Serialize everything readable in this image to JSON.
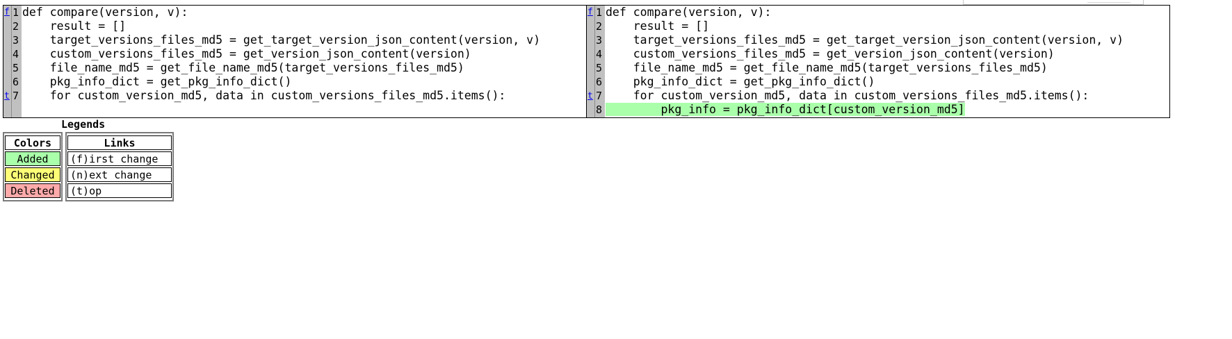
{
  "left_pane": {
    "nav": {
      "first": "f",
      "top": "t"
    },
    "line_numbers": [
      "1",
      "2",
      "3",
      "4",
      "5",
      "6",
      "7"
    ],
    "lines": [
      "def compare(version, v):",
      "    result = []",
      "    target_versions_files_md5 = get_target_version_json_content(version, v)",
      "    custom_versions_files_md5 = get_version_json_content(version)",
      "    file_name_md5 = get_file_name_md5(target_versions_files_md5)",
      "    pkg_info_dict = get_pkg_info_dict()",
      "    for custom_version_md5, data in custom_versions_files_md5.items():"
    ]
  },
  "right_pane": {
    "nav": {
      "first": "f",
      "top": "t"
    },
    "line_numbers": [
      "1",
      "2",
      "3",
      "4",
      "5",
      "6",
      "7",
      "8"
    ],
    "lines": [
      "def compare(version, v):",
      "    result = []",
      "    target_versions_files_md5 = get_target_version_json_content(version, v)",
      "    custom_versions_files_md5 = get_version_json_content(version)",
      "    file_name_md5 = get_file_name_md5(target_versions_files_md5)",
      "    pkg_info_dict = get_pkg_info_dict()",
      "    for custom_version_md5, data in custom_versions_files_md5.items():"
    ],
    "added_line_indent": "        ",
    "added_line": "pkg_info = pkg_info_dict[custom_version_md5]"
  },
  "legend": {
    "title": "Legends",
    "colors_header": "Colors",
    "links_header": "Links",
    "colors": [
      "Added",
      "Changed",
      "Deleted"
    ],
    "links": [
      "(f)irst change",
      "(n)ext change",
      "(t)op"
    ]
  },
  "palette": {
    "added": "#aaffaa",
    "changed": "#ffff77",
    "deleted": "#ffaaaa",
    "gutter": "#c0c0c0"
  }
}
